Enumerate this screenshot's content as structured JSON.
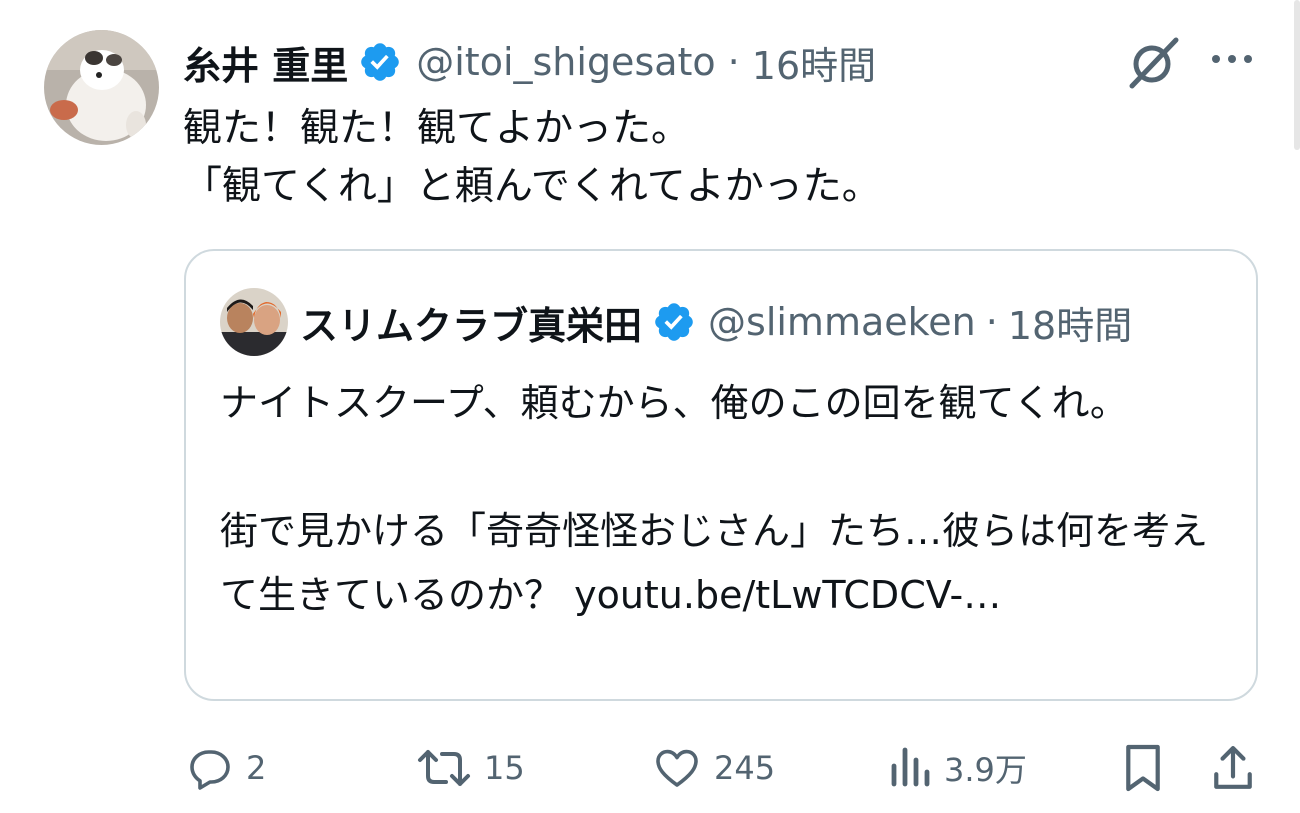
{
  "tweet": {
    "display_name": "糸井 重里",
    "handle": "@itoi_shigesato",
    "separator": "·",
    "time": "16時間",
    "text_lines": [
      "観た！観た！観てよかった。",
      "「観てくれ」と頼んでくれてよかった。"
    ],
    "avatar": "dog-photo-avatar",
    "verified_icon": "verified-badge-icon",
    "accent_color": "#1d9bf0"
  },
  "quote": {
    "display_name": "スリムクラブ真栄田",
    "handle": "@slimmaeken",
    "separator": "·",
    "time": "18時間",
    "text": "ナイトスクープ、頼むから、俺のこの回を観てくれ。\n\n街で見かける「奇奇怪怪おじさん」たち…彼らは何を考えて生きているのか？ youtu.be/tLwTCDCV-…",
    "avatar": "two-people-photo-avatar"
  },
  "actions": {
    "reply_count": "2",
    "retweet_count": "15",
    "like_count": "245",
    "views_count": "3.9万"
  },
  "icons": [
    "grok-icon",
    "more-icon",
    "reply-icon",
    "retweet-icon",
    "like-icon",
    "views-icon",
    "bookmark-icon",
    "share-icon"
  ],
  "colors": {
    "text": "#0f1419",
    "secondary": "#536471",
    "border": "#cfd9de"
  }
}
